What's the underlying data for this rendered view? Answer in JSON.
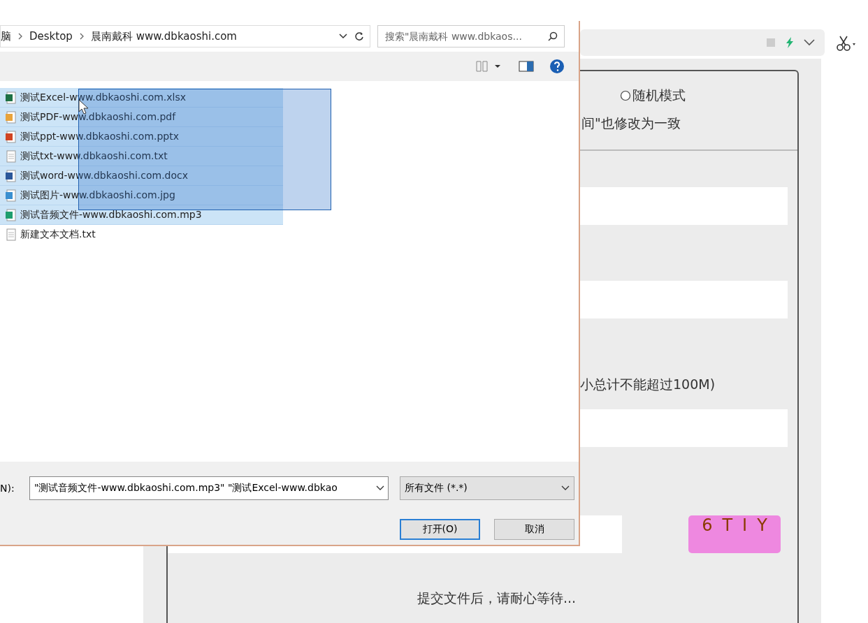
{
  "form": {
    "mode_option": {
      "label": "随机模式",
      "selected": false
    },
    "note": "间\"也修改为一致",
    "size_note": "小总计不能超过100M)",
    "captcha": "6TIY",
    "footer": "提交文件后，请耐心等待..."
  },
  "dialog": {
    "breadcrumb": [
      "脑",
      "Desktop",
      "晨南戴科 www.dbkaoshi.com"
    ],
    "search": {
      "placeholder": "搜索\"晨南戴科 www.dbkaos..."
    },
    "files": [
      {
        "name": "测试Excel-www.dbkaoshi.com.xlsx",
        "kind": "excel",
        "selected": true
      },
      {
        "name": "测试PDF-www.dbkaoshi.com.pdf",
        "kind": "pdf",
        "selected": true
      },
      {
        "name": "测试ppt-www.dbkaoshi.com.pptx",
        "kind": "ppt",
        "selected": true
      },
      {
        "name": "测试txt-www.dbkaoshi.com.txt",
        "kind": "text",
        "selected": true
      },
      {
        "name": "测试word-www.dbkaoshi.com.docx",
        "kind": "word",
        "selected": true
      },
      {
        "name": "测试图片-www.dbkaoshi.com.jpg",
        "kind": "image",
        "selected": true
      },
      {
        "name": "测试音频文件-www.dbkaoshi.com.mp3",
        "kind": "audio",
        "selected": true
      },
      {
        "name": "新建文本文档.txt",
        "kind": "text",
        "selected": false
      }
    ],
    "filename_label": "N):",
    "filename": "\"测试音频文件-www.dbkaoshi.com.mp3\" \"测试Excel-www.dbkao",
    "filetype": "所有文件 (*.*)",
    "buttons": [
      {
        "label": "打开(O)",
        "kind": "primary"
      },
      {
        "label": "取消",
        "kind": "normal"
      }
    ]
  }
}
